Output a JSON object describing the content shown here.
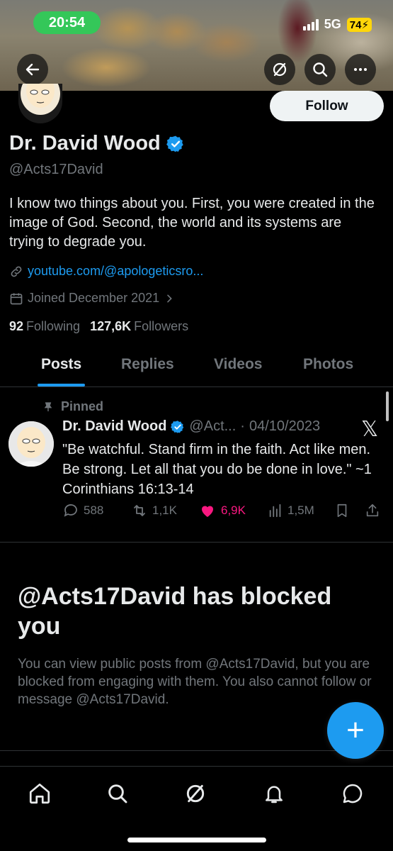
{
  "status_bar": {
    "time": "20:54",
    "network": "5G",
    "battery": "74"
  },
  "header": {
    "back_icon": "arrow-left-icon",
    "grok_icon": "slash-circle-icon",
    "search_icon": "search-icon",
    "more_icon": "more-horizontal-icon"
  },
  "profile": {
    "follow_label": "Follow",
    "display_name": "Dr. David Wood",
    "handle": "@Acts17David",
    "bio": "I know two things about you. First, you were created in the image of God. Second, the world and its systems are trying to degrade you.",
    "link": "youtube.com/@apologeticsro...",
    "joined": "Joined December 2021",
    "following_count": "92",
    "following_label": "Following",
    "followers_count": "127,6K",
    "followers_label": "Followers"
  },
  "tabs": [
    {
      "label": "Posts",
      "active": true
    },
    {
      "label": "Replies",
      "active": false
    },
    {
      "label": "Videos",
      "active": false
    },
    {
      "label": "Photos",
      "active": false
    }
  ],
  "pinned_post": {
    "pinned_label": "Pinned",
    "author": "Dr. David Wood",
    "handle": "@Act...",
    "separator": "·",
    "date": "04/10/2023",
    "text": "\"Be watchful. Stand firm in the faith. Act like men. Be strong. Let all that you do be done in love.\" ~1 Corinthians 16:13-14",
    "replies": "588",
    "reposts": "1,1K",
    "likes": "6,9K",
    "views": "1,5M"
  },
  "blocked": {
    "title": "@Acts17David has blocked you",
    "text": "You can view public posts from @Acts17David, but you are blocked from engaging with them. You also cannot follow or message @Acts17David."
  },
  "fab_label": "+",
  "colors": {
    "accent": "#1d9bf0",
    "like": "#f91880",
    "muted": "#71767b",
    "status_time_bg": "#34c759",
    "battery_bg": "#ffd60a"
  }
}
